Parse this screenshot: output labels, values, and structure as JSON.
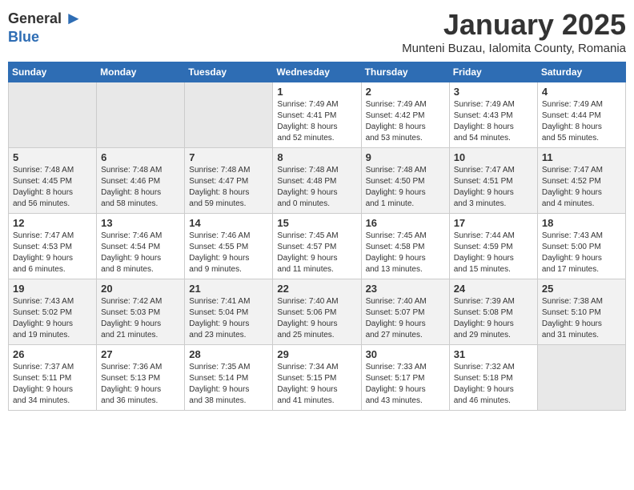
{
  "logo": {
    "general": "General",
    "blue": "Blue"
  },
  "title": "January 2025",
  "subtitle": "Munteni Buzau, Ialomita County, Romania",
  "days_of_week": [
    "Sunday",
    "Monday",
    "Tuesday",
    "Wednesday",
    "Thursday",
    "Friday",
    "Saturday"
  ],
  "weeks": [
    [
      {
        "day": "",
        "info": ""
      },
      {
        "day": "",
        "info": ""
      },
      {
        "day": "",
        "info": ""
      },
      {
        "day": "1",
        "info": "Sunrise: 7:49 AM\nSunset: 4:41 PM\nDaylight: 8 hours\nand 52 minutes."
      },
      {
        "day": "2",
        "info": "Sunrise: 7:49 AM\nSunset: 4:42 PM\nDaylight: 8 hours\nand 53 minutes."
      },
      {
        "day": "3",
        "info": "Sunrise: 7:49 AM\nSunset: 4:43 PM\nDaylight: 8 hours\nand 54 minutes."
      },
      {
        "day": "4",
        "info": "Sunrise: 7:49 AM\nSunset: 4:44 PM\nDaylight: 8 hours\nand 55 minutes."
      }
    ],
    [
      {
        "day": "5",
        "info": "Sunrise: 7:48 AM\nSunset: 4:45 PM\nDaylight: 8 hours\nand 56 minutes."
      },
      {
        "day": "6",
        "info": "Sunrise: 7:48 AM\nSunset: 4:46 PM\nDaylight: 8 hours\nand 58 minutes."
      },
      {
        "day": "7",
        "info": "Sunrise: 7:48 AM\nSunset: 4:47 PM\nDaylight: 8 hours\nand 59 minutes."
      },
      {
        "day": "8",
        "info": "Sunrise: 7:48 AM\nSunset: 4:48 PM\nDaylight: 9 hours\nand 0 minutes."
      },
      {
        "day": "9",
        "info": "Sunrise: 7:48 AM\nSunset: 4:50 PM\nDaylight: 9 hours\nand 1 minute."
      },
      {
        "day": "10",
        "info": "Sunrise: 7:47 AM\nSunset: 4:51 PM\nDaylight: 9 hours\nand 3 minutes."
      },
      {
        "day": "11",
        "info": "Sunrise: 7:47 AM\nSunset: 4:52 PM\nDaylight: 9 hours\nand 4 minutes."
      }
    ],
    [
      {
        "day": "12",
        "info": "Sunrise: 7:47 AM\nSunset: 4:53 PM\nDaylight: 9 hours\nand 6 minutes."
      },
      {
        "day": "13",
        "info": "Sunrise: 7:46 AM\nSunset: 4:54 PM\nDaylight: 9 hours\nand 8 minutes."
      },
      {
        "day": "14",
        "info": "Sunrise: 7:46 AM\nSunset: 4:55 PM\nDaylight: 9 hours\nand 9 minutes."
      },
      {
        "day": "15",
        "info": "Sunrise: 7:45 AM\nSunset: 4:57 PM\nDaylight: 9 hours\nand 11 minutes."
      },
      {
        "day": "16",
        "info": "Sunrise: 7:45 AM\nSunset: 4:58 PM\nDaylight: 9 hours\nand 13 minutes."
      },
      {
        "day": "17",
        "info": "Sunrise: 7:44 AM\nSunset: 4:59 PM\nDaylight: 9 hours\nand 15 minutes."
      },
      {
        "day": "18",
        "info": "Sunrise: 7:43 AM\nSunset: 5:00 PM\nDaylight: 9 hours\nand 17 minutes."
      }
    ],
    [
      {
        "day": "19",
        "info": "Sunrise: 7:43 AM\nSunset: 5:02 PM\nDaylight: 9 hours\nand 19 minutes."
      },
      {
        "day": "20",
        "info": "Sunrise: 7:42 AM\nSunset: 5:03 PM\nDaylight: 9 hours\nand 21 minutes."
      },
      {
        "day": "21",
        "info": "Sunrise: 7:41 AM\nSunset: 5:04 PM\nDaylight: 9 hours\nand 23 minutes."
      },
      {
        "day": "22",
        "info": "Sunrise: 7:40 AM\nSunset: 5:06 PM\nDaylight: 9 hours\nand 25 minutes."
      },
      {
        "day": "23",
        "info": "Sunrise: 7:40 AM\nSunset: 5:07 PM\nDaylight: 9 hours\nand 27 minutes."
      },
      {
        "day": "24",
        "info": "Sunrise: 7:39 AM\nSunset: 5:08 PM\nDaylight: 9 hours\nand 29 minutes."
      },
      {
        "day": "25",
        "info": "Sunrise: 7:38 AM\nSunset: 5:10 PM\nDaylight: 9 hours\nand 31 minutes."
      }
    ],
    [
      {
        "day": "26",
        "info": "Sunrise: 7:37 AM\nSunset: 5:11 PM\nDaylight: 9 hours\nand 34 minutes."
      },
      {
        "day": "27",
        "info": "Sunrise: 7:36 AM\nSunset: 5:13 PM\nDaylight: 9 hours\nand 36 minutes."
      },
      {
        "day": "28",
        "info": "Sunrise: 7:35 AM\nSunset: 5:14 PM\nDaylight: 9 hours\nand 38 minutes."
      },
      {
        "day": "29",
        "info": "Sunrise: 7:34 AM\nSunset: 5:15 PM\nDaylight: 9 hours\nand 41 minutes."
      },
      {
        "day": "30",
        "info": "Sunrise: 7:33 AM\nSunset: 5:17 PM\nDaylight: 9 hours\nand 43 minutes."
      },
      {
        "day": "31",
        "info": "Sunrise: 7:32 AM\nSunset: 5:18 PM\nDaylight: 9 hours\nand 46 minutes."
      },
      {
        "day": "",
        "info": ""
      }
    ]
  ]
}
